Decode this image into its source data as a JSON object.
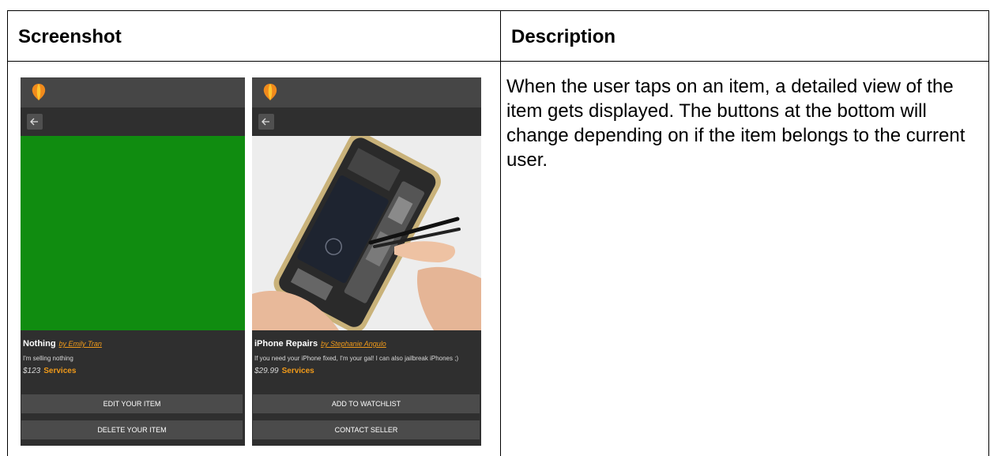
{
  "table": {
    "headers": {
      "screenshot": "Screenshot",
      "description": "Description"
    },
    "description_text": "When the user taps on an item, a detailed view of the item gets displayed. The buttons at the bottom will change depending on if the item belongs to the current user."
  },
  "phones": [
    {
      "item_title": "Nothing",
      "seller": "by Emily Tran",
      "description": "I'm selling nothing",
      "price": "$123",
      "category": "Services",
      "image_color": "#108c10",
      "buttons": [
        "EDIT YOUR ITEM",
        "DELETE YOUR ITEM"
      ]
    },
    {
      "item_title": "iPhone Repairs",
      "seller": "by Stephanie Angulo",
      "description": "If you need your iPhone fixed, I'm your gal! I can also jailbreak iPhones ;)",
      "price": "$29.99",
      "category": "Services",
      "buttons": [
        "ADD TO WATCHLIST",
        "CONTACT SELLER"
      ]
    }
  ],
  "colors": {
    "accent": "#f09a1a",
    "app_bar": "#464646",
    "screen_bg": "#2f2f2f",
    "button_bg": "#4b4b4b"
  },
  "icons": {
    "logo": "balloon-logo-icon",
    "back": "arrow-left-icon"
  }
}
